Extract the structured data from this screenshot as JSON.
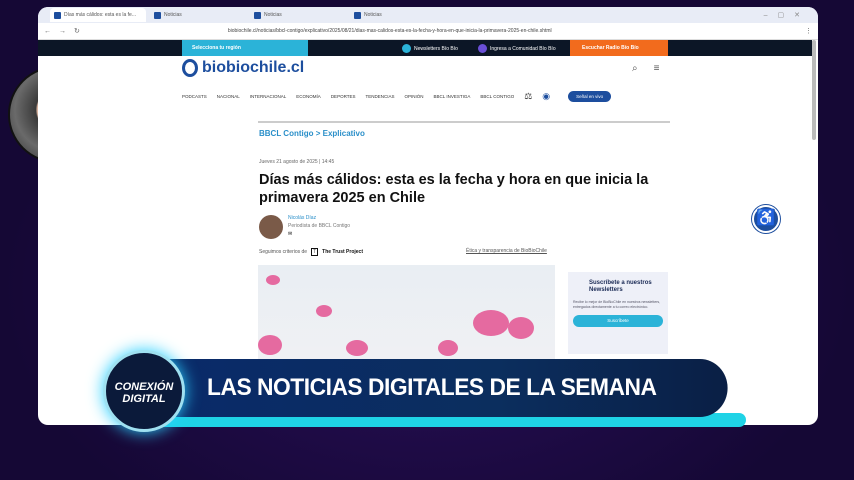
{
  "browser": {
    "tabs": [
      "Días más cálidos: esta es la fe...",
      "Noticias",
      "Noticias",
      "Noticias"
    ],
    "url": "biobiochile.cl/noticias/bbcl-contigo/explicativo/2025/08/21/dias-mas-calidos-esta-es-la-fecha-y-hora-en-que-inicia-la-primavera-2025-en-chile.shtml"
  },
  "site": {
    "region": "Selecciona tu región",
    "newsletters": "Newsletters Bío Bío",
    "community": "Ingresa a Comunidad Bío Bío",
    "listen": "Escuchar Radio Bío Bío",
    "logo": "biobiochile.cl",
    "nav": [
      "PODCASTS",
      "NACIONAL",
      "INTERNACIONAL",
      "ECONOMÍA",
      "DEPORTES",
      "TENDENCIAS",
      "OPINIÓN",
      "BBCL INVESTIGA",
      "BBCL CONTIGO"
    ],
    "live": "Señal en vivo"
  },
  "article": {
    "breadcrumb": "BBCL Contigo > Explicativo",
    "date": "Jueves 21 agosto de 2025 | 14:45",
    "title": "Días más cálidos: esta es la fecha y hora en que inicia la primavera 2025 en Chile",
    "author": "Nicolás Díaz",
    "role": "Periodista de BBCL Contigo",
    "trust_prefix": "Seguimos criterios de",
    "trust": "The Trust Project",
    "ethics": "Ética y transparencia de BioBioChile"
  },
  "newsletter": {
    "title": "Suscríbete a nuestros Newsletters",
    "desc": "Recibe lo mejor de BioBioChile en nuestros newsletters, entregados directamente a tu correo electrónico.",
    "button": "Suscríbete"
  },
  "overlay": {
    "logo": "CONEXIÓN DIGITAL",
    "headline": "LAS NOTICIAS DIGITALES DE LA SEMANA"
  }
}
